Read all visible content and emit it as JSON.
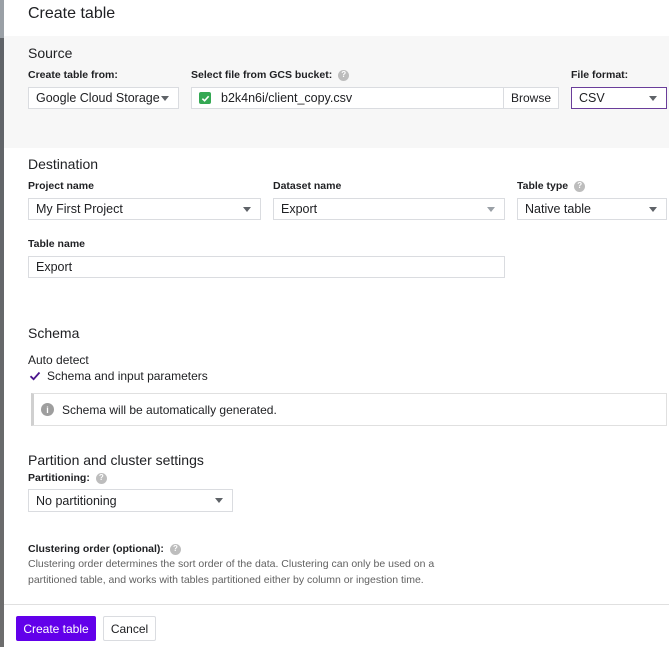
{
  "dialog": {
    "title": "Create table"
  },
  "source": {
    "title": "Source",
    "create_from_label": "Create table from:",
    "create_from_value": "Google Cloud Storage",
    "gcs_label": "Select file from GCS bucket:",
    "gcs_value": "b2k4n6i/client_copy.csv",
    "browse_label": "Browse",
    "format_label": "File format:",
    "format_value": "CSV"
  },
  "destination": {
    "title": "Destination",
    "project_label": "Project name",
    "project_value": "My First Project",
    "dataset_label": "Dataset name",
    "dataset_value": "Export",
    "table_type_label": "Table type",
    "table_type_value": "Native table",
    "table_name_label": "Table name",
    "table_name_value": "Export"
  },
  "schema": {
    "title": "Schema",
    "auto_detect_label": "Auto detect",
    "checkbox_label": "Schema and input parameters",
    "checkbox_checked": true,
    "info_text": "Schema will be automatically generated."
  },
  "partition": {
    "title": "Partition and cluster settings",
    "partitioning_label": "Partitioning:",
    "partitioning_value": "No partitioning",
    "clustering_label": "Clustering order (optional):",
    "clustering_description": "Clustering order determines the sort order of the data. Clustering can only be used on a partitioned table, and works with tables partitioned either by column or ingestion time."
  },
  "footer": {
    "create_label": "Create table",
    "cancel_label": "Cancel"
  },
  "colors": {
    "primary": "#6200ea",
    "focus_border": "#6a3d9a",
    "success": "#34a853"
  },
  "icons": {
    "help": "help-circle-icon",
    "info": "info-circle-icon",
    "file_ok": "check-square-icon",
    "dropdown": "caret-down-icon"
  }
}
